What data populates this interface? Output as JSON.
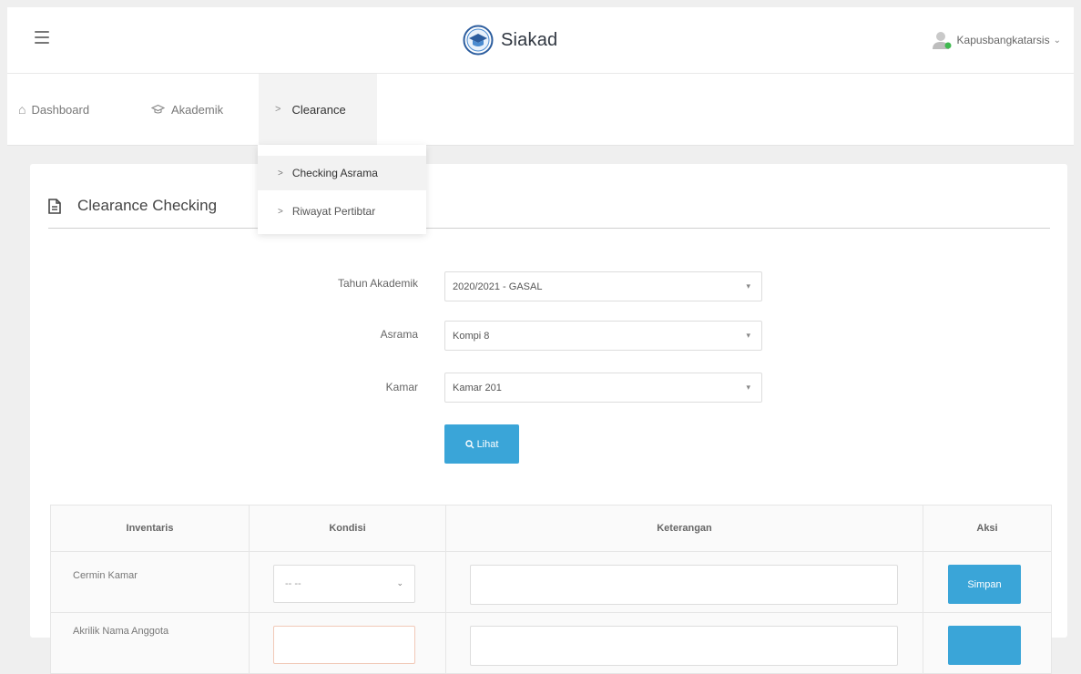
{
  "header": {
    "brand": "Siakad",
    "user_name": "Kapusbangkatarsis",
    "user_caret": "⌄",
    "menu_icon": "hamburger-icon",
    "logo_icon": "graduation-cap-logo"
  },
  "nav": {
    "items": [
      {
        "label": "Dashboard",
        "icon": "home-icon"
      },
      {
        "label": "Akademik",
        "icon": "graduation-cap-icon"
      },
      {
        "label": "Clearance",
        "icon": "chevron-right-icon"
      }
    ]
  },
  "dropdown": {
    "items": [
      {
        "label": "Checking Asrama"
      },
      {
        "label": "Riwayat Pertibtar"
      }
    ]
  },
  "card": {
    "title": "Clearance Checking",
    "icon": "document-icon"
  },
  "form": {
    "tahun_label": "Tahun Akademik",
    "tahun_value": "2020/2021 - GASAL",
    "asrama_label": "Asrama",
    "asrama_value": "Kompi 8",
    "kamar_label": "Kamar",
    "kamar_value": "Kamar 201",
    "button_label": "Lihat"
  },
  "table": {
    "headers": [
      "Inventaris",
      "Kondisi",
      "Keterangan",
      "Aksi"
    ],
    "rows": [
      {
        "inventaris": "Cermin Kamar",
        "kondisi": "-- --",
        "keterangan": "",
        "aksi": "Simpan"
      },
      {
        "inventaris": "Akrilik Nama Anggota",
        "kondisi": "",
        "keterangan": "",
        "aksi": ""
      }
    ]
  },
  "colors": {
    "accent": "#3aa5d8",
    "page_bg": "#efefef"
  }
}
